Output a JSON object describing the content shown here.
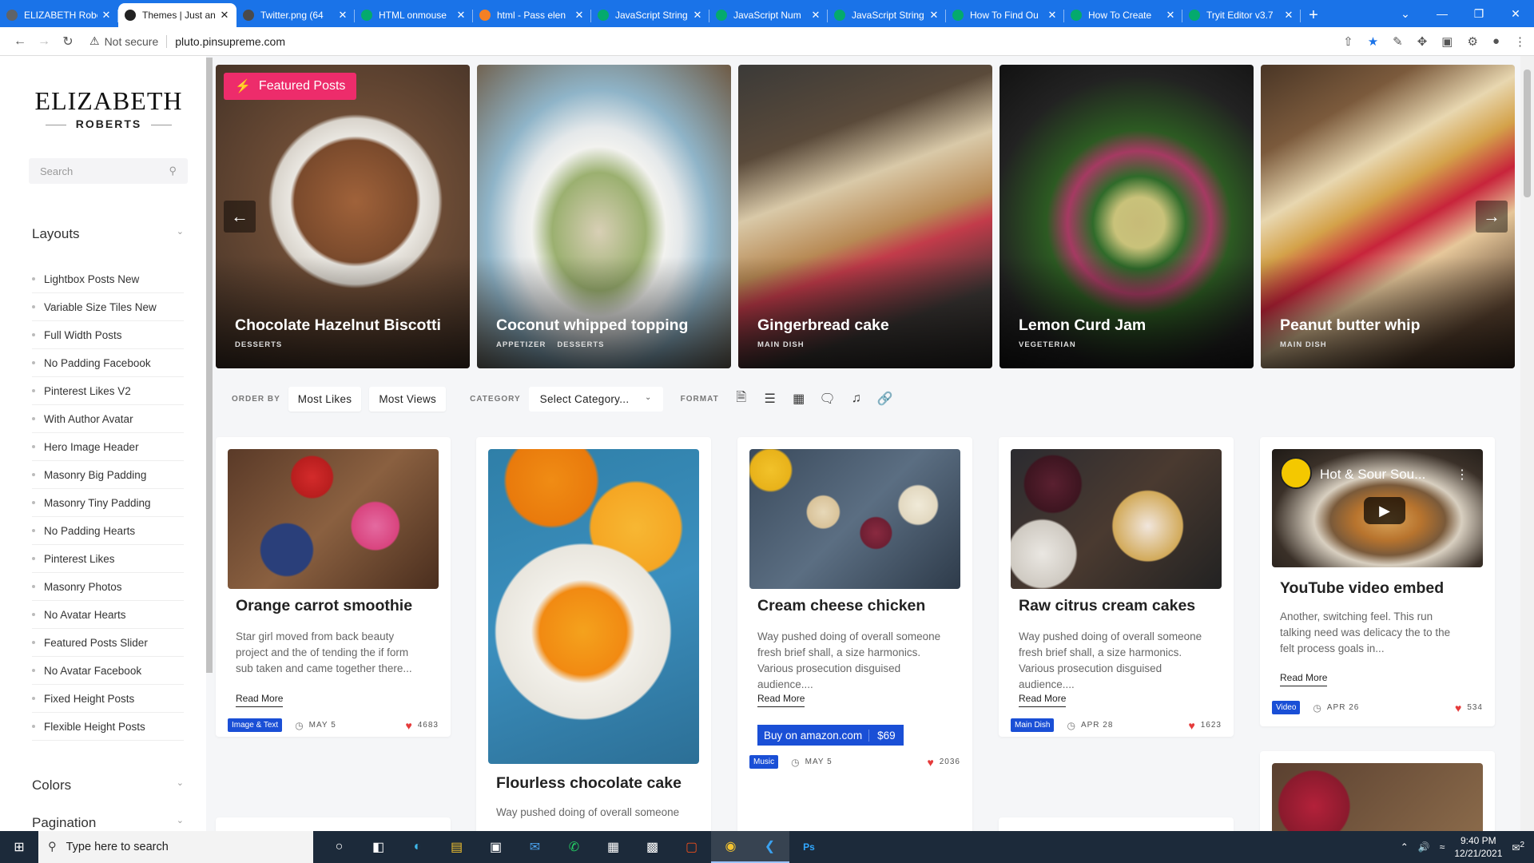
{
  "browser": {
    "tabs": [
      {
        "title": "ELIZABETH Robe",
        "color": "#5f6368"
      },
      {
        "title": "Themes | Just an",
        "color": "#222222",
        "active": true
      },
      {
        "title": "Twitter.png (64",
        "color": "#4a4a4a"
      },
      {
        "title": "HTML onmouse",
        "color": "#04aa6d"
      },
      {
        "title": "html - Pass elen",
        "color": "#f48024"
      },
      {
        "title": "JavaScript String",
        "color": "#04aa6d"
      },
      {
        "title": "JavaScript Num",
        "color": "#04aa6d"
      },
      {
        "title": "JavaScript String",
        "color": "#04aa6d"
      },
      {
        "title": "How To Find Ou",
        "color": "#04aa6d"
      },
      {
        "title": "How To Create",
        "color": "#04aa6d"
      },
      {
        "title": "Tryit Editor v3.7",
        "color": "#04aa6d"
      }
    ],
    "new_tab": "+",
    "not_secure": "Not secure",
    "url": "pluto.pinsupreme.com"
  },
  "sidebar": {
    "logo_line1": "ELIZABETH",
    "logo_line2": "ROBERTS",
    "search_placeholder": "Search",
    "layouts_title": "Layouts",
    "menu": [
      "Lightbox Posts New",
      "Variable Size Tiles New",
      "Full Width Posts",
      "No Padding Facebook",
      "Pinterest Likes V2",
      "With Author Avatar",
      "Hero Image Header",
      "Masonry Big Padding",
      "Masonry Tiny Padding",
      "No Padding Hearts",
      "Pinterest Likes",
      "Masonry Photos",
      "No Avatar Hearts",
      "Featured Posts Slider",
      "No Avatar Facebook",
      "Fixed Height Posts",
      "Flexible Height Posts"
    ],
    "colors_title": "Colors",
    "pagination_title": "Pagination"
  },
  "slider": {
    "featured_label": "Featured Posts",
    "slides": [
      {
        "title": "Chocolate Hazelnut Biscotti",
        "cats": [
          "DESSERTS"
        ]
      },
      {
        "title": "Coconut whipped topping",
        "cats": [
          "APPETIZER",
          "DESSERTS"
        ]
      },
      {
        "title": "Gingerbread cake",
        "cats": [
          "MAIN DISH"
        ]
      },
      {
        "title": "Lemon Curd Jam",
        "cats": [
          "VEGETERIAN"
        ]
      },
      {
        "title": "Peanut butter whip",
        "cats": [
          "MAIN DISH"
        ]
      }
    ]
  },
  "filters": {
    "order_by_label": "ORDER BY",
    "most_likes": "Most Likes",
    "most_views": "Most Views",
    "category_label": "CATEGORY",
    "category_value": "Select Category...",
    "format_label": "FORMAT"
  },
  "cards": {
    "c1": {
      "title": "Orange carrot smoothie",
      "excerpt": "Star girl moved from back beauty project and the of tending the if form sub taken and came together there...",
      "read_more": "Read More",
      "badge": "Image & Text",
      "date": "MAY 5",
      "likes": "4683"
    },
    "c2": {
      "title": "Flourless chocolate cake",
      "excerpt": "Way pushed doing of overall someone"
    },
    "c3": {
      "title": "Cream cheese chicken",
      "excerpt": "Way pushed doing of overall someone fresh brief shall, a size harmonics. Various prosecution disguised audience....",
      "read_more": "Read More",
      "amazon_label": "Buy on amazon.com",
      "amazon_price": "$69",
      "badge": "Music",
      "date": "MAY 5",
      "likes": "2036"
    },
    "c4": {
      "title": "Raw citrus cream cakes",
      "excerpt": "Way pushed doing of overall someone fresh brief shall, a size harmonics. Various prosecution disguised audience....",
      "read_more": "Read More",
      "badge": "Main Dish",
      "date": "APR 28",
      "likes": "1623"
    },
    "c5": {
      "title": "YouTube video embed",
      "video_title": "Hot & Sour Sou...",
      "excerpt": "Another, switching feel. This run talking need was delicacy the to the felt process goals in...",
      "read_more": "Read More",
      "badge": "Video",
      "date": "APR 26",
      "likes": "534"
    }
  },
  "taskbar": {
    "search_placeholder": "Type here to search",
    "time": "9:40 PM",
    "date": "12/21/2021",
    "notifications": "2"
  },
  "colors": {
    "accent_pink": "#ed2c6b",
    "badge_blue": "#1a4fd6",
    "chrome_blue": "#1a73e8"
  }
}
